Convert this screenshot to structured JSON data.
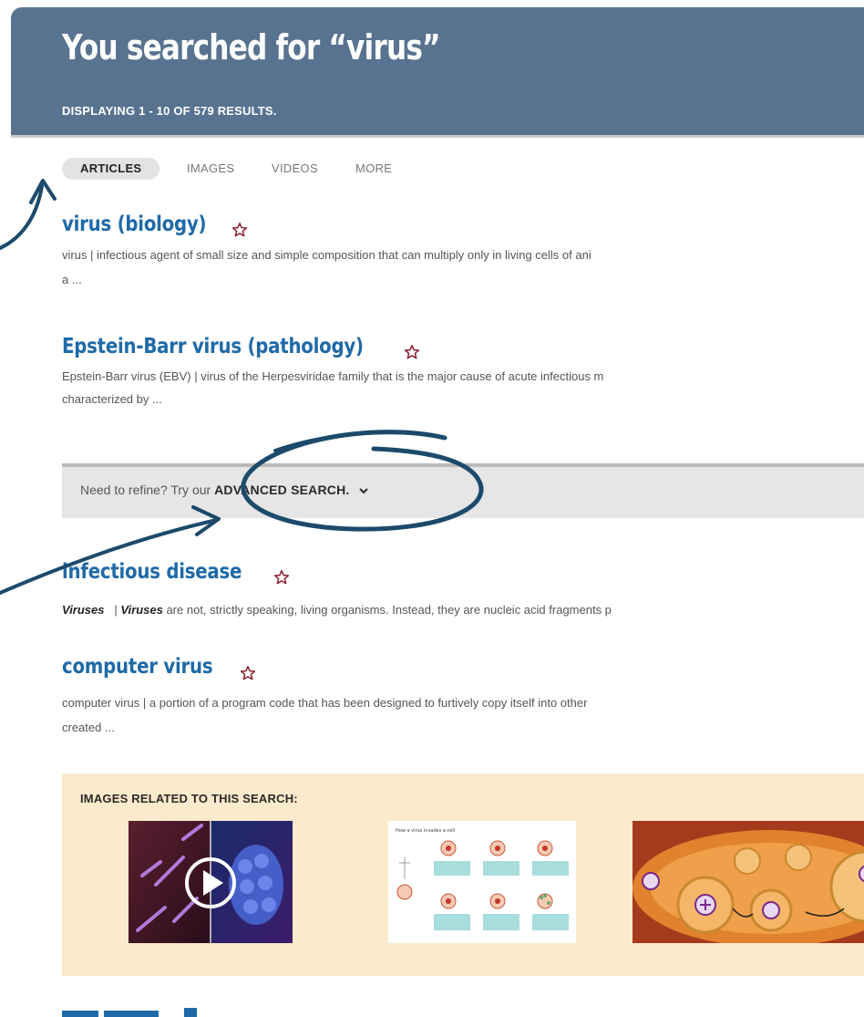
{
  "header": {
    "title": "You searched for “virus”",
    "count": "DISPLAYING 1 - 10 OF 579 RESULTS."
  },
  "tabs": [
    {
      "label": "ARTICLES",
      "active": true
    },
    {
      "label": "IMAGES",
      "active": false
    },
    {
      "label": "VIDEOS",
      "active": false
    },
    {
      "label": "MORE",
      "active": false
    }
  ],
  "results": [
    {
      "title": "virus (biology)",
      "lines": [
        "virus   |   infectious agent of small size and simple composition that can multiply only in living cells of ani",
        "a ..."
      ]
    },
    {
      "title": "Epstein-Barr virus (pathology)",
      "lines": [
        "Epstein-Barr virus (EBV)   |   virus of the Herpesviridae family that is the major cause of acute infectious m",
        "characterized by ..."
      ]
    },
    {
      "title": "infectious disease",
      "lines": [
        "are not, strictly speaking, living organisms. Instead, they are nucleic acid fragments p"
      ],
      "bold_term": "Viruses"
    },
    {
      "title": "computer virus",
      "lines": [
        "computer virus   |   a portion of a program code that has been designed to furtively copy itself into other",
        "created ..."
      ]
    }
  ],
  "refine": {
    "prefix": "Need to refine? Try our ",
    "link": "ADVANCED SEARCH.",
    "chevron": "chevron-down-icon"
  },
  "images": {
    "label": "IMAGES RELATED TO THIS SEARCH:"
  },
  "colors": {
    "header": "#587390",
    "title_link": "#1f6aa8",
    "star": "#8b2333",
    "annotation": "#1c4a6b",
    "images_bg": "#fbeacb"
  }
}
